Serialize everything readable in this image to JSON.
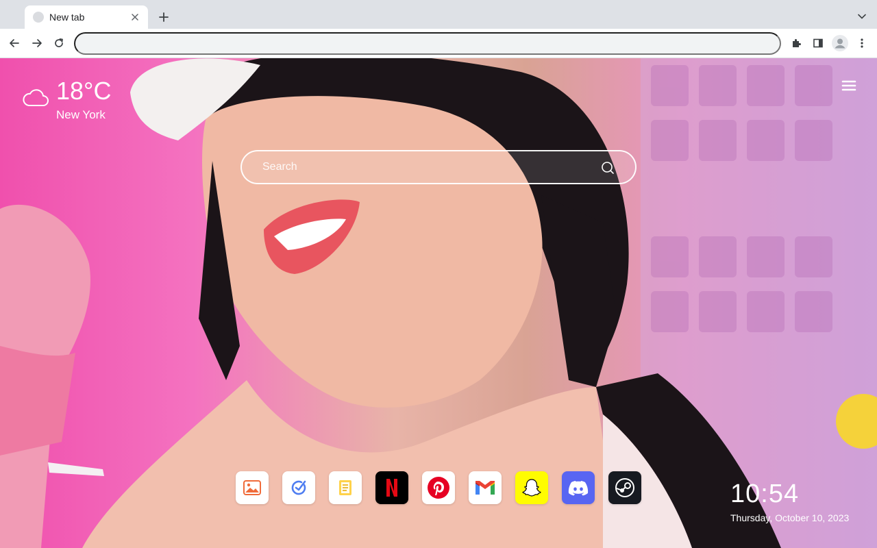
{
  "browser": {
    "tab": {
      "title": "New tab"
    },
    "address_bar": {
      "value": ""
    }
  },
  "weather": {
    "temperature": "18°C",
    "city": "New York",
    "icon": "cloud-icon"
  },
  "search": {
    "placeholder": "Search"
  },
  "shortcuts": [
    {
      "name": "photos",
      "icon": "image-icon",
      "bg": "#ffffff"
    },
    {
      "name": "tasks",
      "icon": "check-icon",
      "bg": "#ffffff"
    },
    {
      "name": "notes",
      "icon": "notes-icon",
      "bg": "#ffffff"
    },
    {
      "name": "netflix",
      "icon": "netflix-icon",
      "bg": "#000000"
    },
    {
      "name": "pinterest",
      "icon": "pinterest-icon",
      "bg": "#ffffff"
    },
    {
      "name": "gmail",
      "icon": "gmail-icon",
      "bg": "#ffffff"
    },
    {
      "name": "snapchat",
      "icon": "snapchat-icon",
      "bg": "#fffc00"
    },
    {
      "name": "discord",
      "icon": "discord-icon",
      "bg": "#5865f2"
    },
    {
      "name": "steam",
      "icon": "steam-icon",
      "bg": "#171a21"
    }
  ],
  "clock": {
    "time": "10:54",
    "date": "Thursday, October 10, 2023"
  },
  "colors": {
    "accent_pink": "#f050ad",
    "tab_strip": "#dee1e6",
    "omnibox": "#f1f3f4"
  }
}
